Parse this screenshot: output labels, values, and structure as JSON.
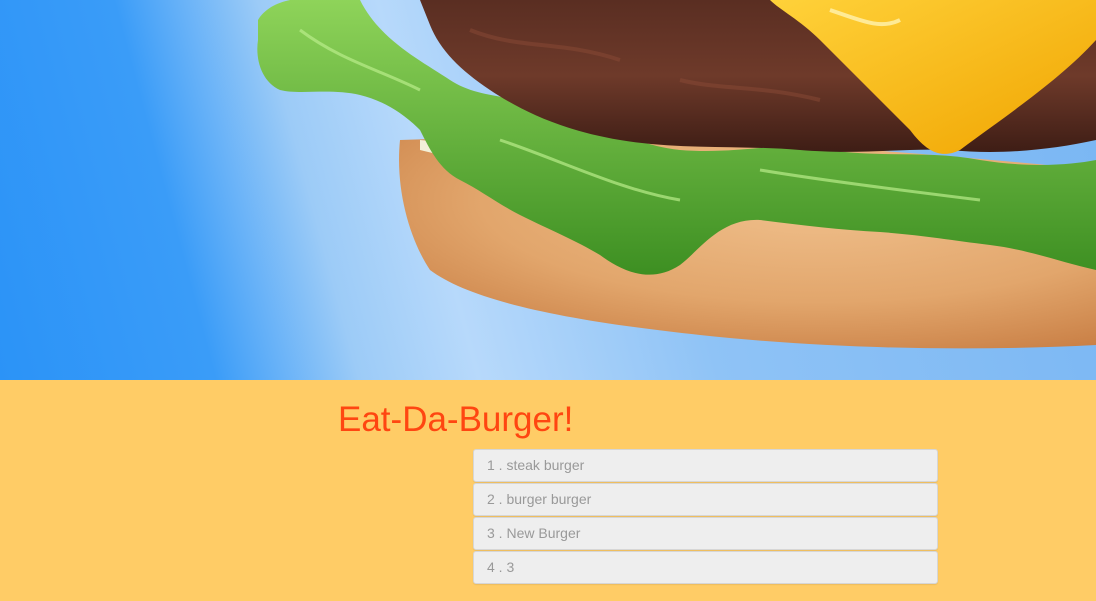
{
  "hero": {
    "image": "burger-photo"
  },
  "main": {
    "title": "Eat-Da-Burger!",
    "burgers": [
      {
        "id": "1",
        "name": "steak burger"
      },
      {
        "id": "2",
        "name": "burger burger"
      },
      {
        "id": "3",
        "name": "New Burger"
      },
      {
        "id": "4",
        "name": "3"
      }
    ],
    "separator": " . "
  },
  "colors": {
    "hero_blue": "#2b93f7",
    "background": "#ffcc66",
    "title": "#ff4611",
    "item_bg": "#eeeeee",
    "item_text": "#999999"
  }
}
